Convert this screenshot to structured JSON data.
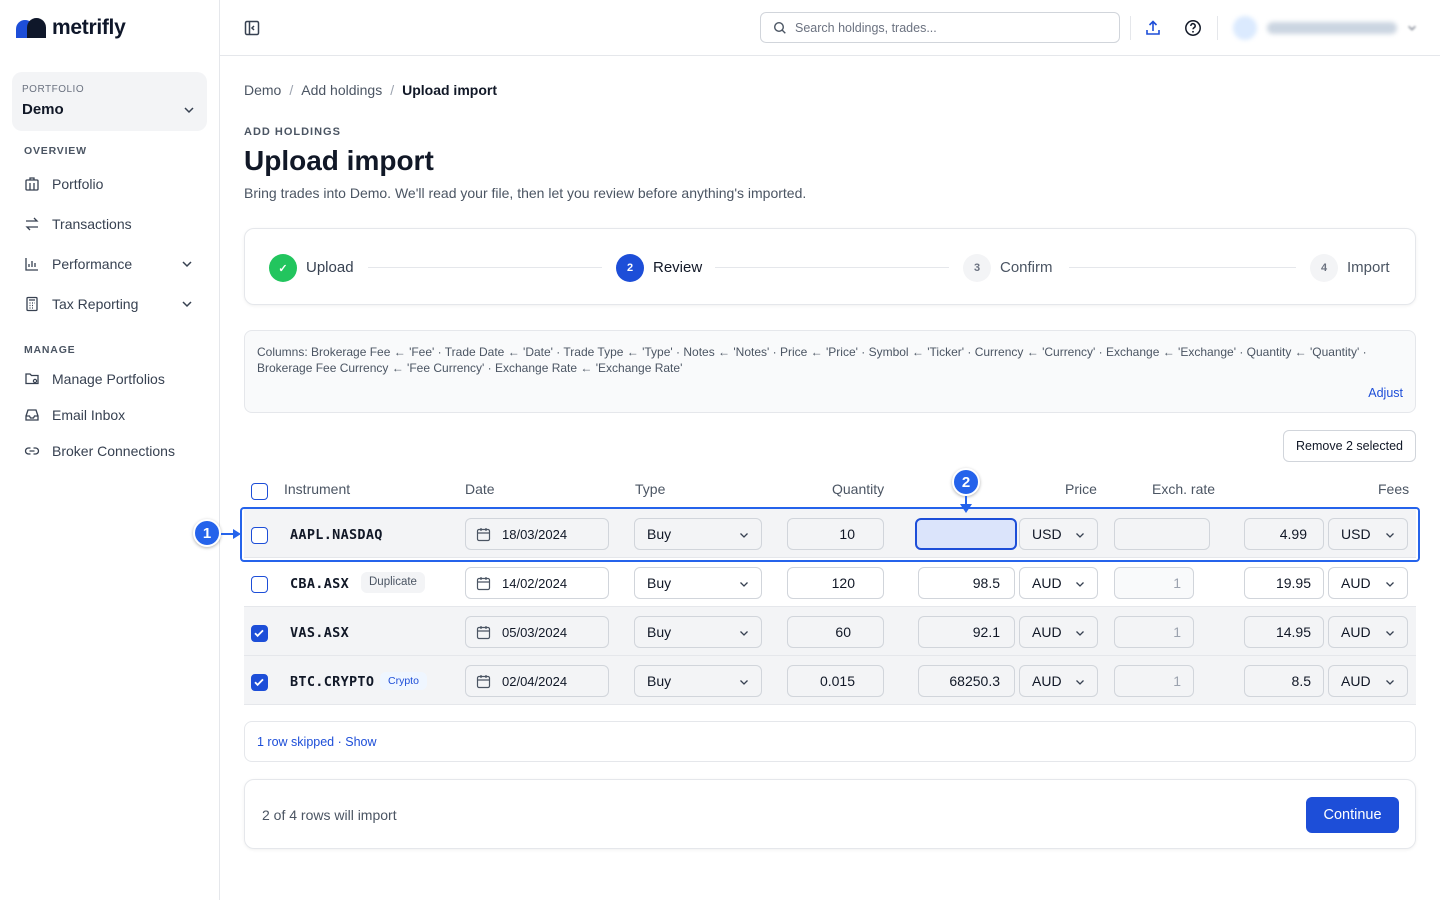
{
  "brand": {
    "name": "metrifly",
    "accent": "#1d4ed8"
  },
  "sidebar": {
    "portfolio_label": "PORTFOLIO",
    "portfolio_value": "Demo",
    "overview_label": "OVERVIEW",
    "manage_label": "MANAGE",
    "items": [
      {
        "label": "Portfolio",
        "icon": "building-icon"
      },
      {
        "label": "Transactions",
        "icon": "swap-arrows-icon"
      },
      {
        "label": "Performance",
        "icon": "bar-chart-icon"
      },
      {
        "label": "Tax Reporting",
        "icon": "calculator-icon"
      },
      {
        "label": "Manage Portfolios",
        "icon": "folder-gear-icon"
      },
      {
        "label": "Email Inbox",
        "icon": "inbox-icon"
      },
      {
        "label": "Broker Connections",
        "icon": "link-icon"
      }
    ]
  },
  "topbar": {
    "search_placeholder": "Search holdings, trades..."
  },
  "breadcrumb": [
    "Demo",
    "Add holdings",
    "Upload import"
  ],
  "header": {
    "eyebrow": "ADD HOLDINGS",
    "title": "Upload import",
    "subtitle": "Bring trades into Demo. We'll read your file, then let you review before anything's imported."
  },
  "steps": [
    {
      "label": "Upload",
      "marker": "✓",
      "state": "done"
    },
    {
      "label": "Review",
      "marker": "2",
      "state": "active"
    },
    {
      "label": "Confirm",
      "marker": "3",
      "state": "pending"
    },
    {
      "label": "Import",
      "marker": "4",
      "state": "pending"
    }
  ],
  "mapping": {
    "text": "Columns: Brokerage Fee ← 'Fee' · Trade Date ← 'Date' · Trade Type ← 'Type' · Notes ← 'Notes' · Price ← 'Price' · Symbol ← 'Ticker' · Currency ← 'Currency' · Exchange ← 'Exchange' · Quantity ← 'Quantity' · Brokerage Fee Currency ← 'Fee Currency' · Exchange Rate ← 'Exchange Rate'",
    "adjust_label": "Adjust"
  },
  "table": {
    "remove_label": "Remove 2 selected",
    "headers": {
      "instrument": "Instrument",
      "date": "Date",
      "type": "Type",
      "quantity": "Quantity",
      "price": "Price",
      "exch_rate": "Exch. rate",
      "fees": "Fees"
    },
    "rows": [
      {
        "symbol": "AAPL.NASDAQ",
        "badge": "",
        "date": "18/03/2024",
        "type": "Buy",
        "quantity": "10",
        "price": "",
        "price_ccy": "USD",
        "exch_rate": "",
        "fees": "4.99",
        "fee_ccy": "USD",
        "checked": false
      },
      {
        "symbol": "CBA.ASX",
        "badge": "Duplicate",
        "date": "14/02/2024",
        "type": "Buy",
        "quantity": "120",
        "price": "98.5",
        "price_ccy": "AUD",
        "exch_rate": "1",
        "fees": "19.95",
        "fee_ccy": "AUD",
        "checked": false
      },
      {
        "symbol": "VAS.ASX",
        "badge": "",
        "date": "05/03/2024",
        "type": "Buy",
        "quantity": "60",
        "price": "92.1",
        "price_ccy": "AUD",
        "exch_rate": "1",
        "fees": "14.95",
        "fee_ccy": "AUD",
        "checked": true
      },
      {
        "symbol": "BTC.CRYPTO",
        "badge": "Crypto",
        "date": "02/04/2024",
        "type": "Buy",
        "quantity": "0.015",
        "price": "68250.3",
        "price_ccy": "AUD",
        "exch_rate": "1",
        "fees": "8.5",
        "fee_ccy": "AUD",
        "checked": true
      }
    ]
  },
  "annotations": {
    "marker_1": "1",
    "marker_2": "2"
  },
  "skipped": {
    "text": "1 row skipped · Show"
  },
  "footer": {
    "count_text": "2 of 4 rows will import",
    "continue_label": "Continue"
  }
}
